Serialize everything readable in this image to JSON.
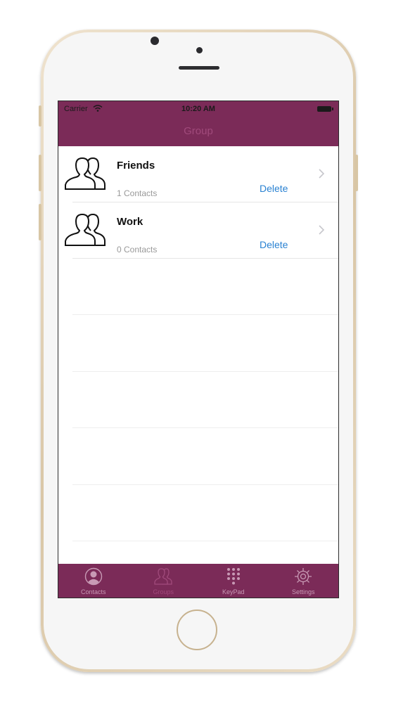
{
  "status_bar": {
    "carrier": "Carrier",
    "time": "10:20 AM"
  },
  "nav": {
    "title": "Group"
  },
  "groups": [
    {
      "name": "Friends",
      "count": "1 Contacts",
      "delete_label": "Delete"
    },
    {
      "name": "Work",
      "count": "0 Contacts",
      "delete_label": "Delete"
    }
  ],
  "tab_bar": {
    "active": "groups",
    "tabs": [
      {
        "label": "Contacts",
        "icon": "contact-icon"
      },
      {
        "label": "Groups",
        "icon": "group-icon"
      },
      {
        "label": "KeyPad",
        "icon": "keypad-icon"
      },
      {
        "label": "Settings",
        "icon": "gear-icon"
      }
    ]
  },
  "colors": {
    "accent": "#7b2b58",
    "link": "#2a82d2",
    "phone_frame": "#d9c6a6"
  }
}
